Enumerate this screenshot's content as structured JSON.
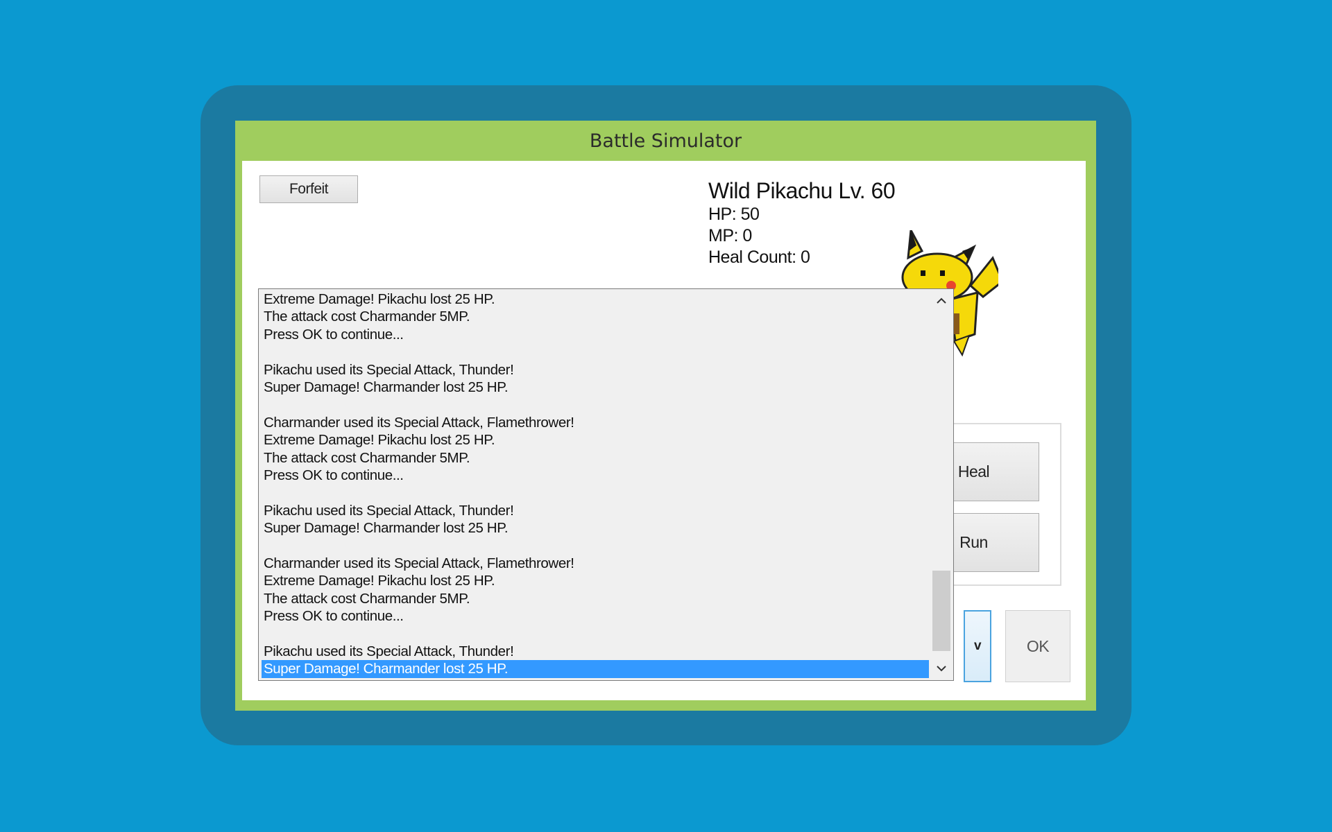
{
  "window": {
    "title": "Battle Simulator"
  },
  "toolbar": {
    "forfeit_label": "Forfeit"
  },
  "enemy": {
    "name": "Wild Pikachu Lv. 60",
    "hp": "HP: 50",
    "mp": "MP: 0",
    "heal_count": "Heal Count: 0"
  },
  "actions": {
    "heal_label": "Heal",
    "run_label": "Run",
    "toggle_label": "v",
    "ok_label": "OK"
  },
  "battle_log": {
    "lines": [
      "Extreme Damage! Pikachu lost 25 HP.",
      "The attack cost Charmander 5MP.",
      "Press OK to continue...",
      "",
      "Pikachu used its Special Attack, Thunder!",
      "Super Damage! Charmander lost 25 HP.",
      "",
      "Charmander used its Special Attack, Flamethrower!",
      "Extreme Damage! Pikachu lost 25 HP.",
      "The attack cost Charmander 5MP.",
      "Press OK to continue...",
      "",
      "Pikachu used its Special Attack, Thunder!",
      "Super Damage! Charmander lost 25 HP.",
      "",
      "Charmander used its Special Attack, Flamethrower!",
      "Extreme Damage! Pikachu lost 25 HP.",
      "The attack cost Charmander 5MP.",
      "Press OK to continue...",
      "",
      "Pikachu used its Special Attack, Thunder!",
      "Super Damage! Charmander lost 25 HP."
    ],
    "selected_index": 21
  },
  "icons": {
    "scroll_up": "chevron-up-icon",
    "scroll_down": "chevron-down-icon",
    "sprite": "pikachu-sprite"
  },
  "colors": {
    "background": "#0b99d0",
    "frame": "#1b7aa1",
    "window_border": "#a0cd5e",
    "selection": "#3399ff"
  }
}
